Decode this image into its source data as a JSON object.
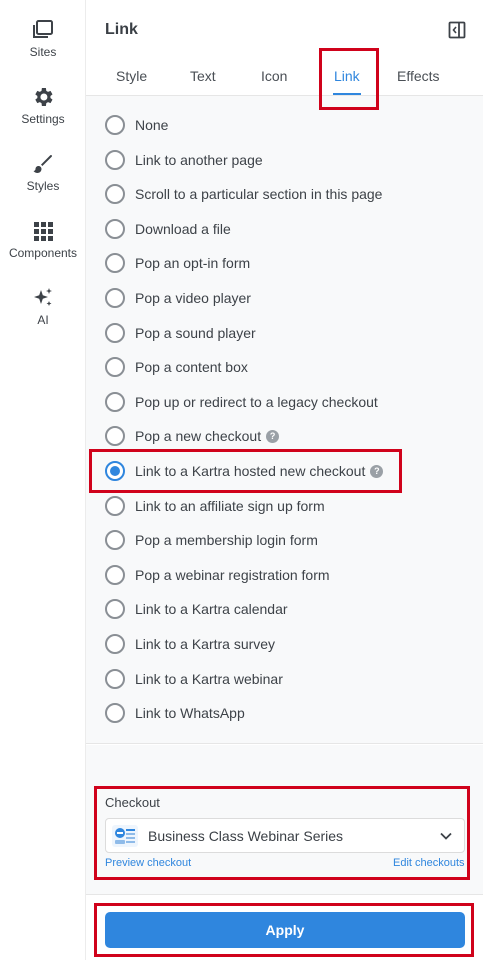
{
  "sidebar": {
    "items": [
      {
        "label": "Sites",
        "icon": "sites-icon"
      },
      {
        "label": "Settings",
        "icon": "gear-icon"
      },
      {
        "label": "Styles",
        "icon": "brush-icon"
      },
      {
        "label": "Components",
        "icon": "grid-icon"
      },
      {
        "label": "AI",
        "icon": "sparkle-icon"
      }
    ]
  },
  "panel": {
    "title": "Link",
    "tabs": [
      {
        "label": "Style"
      },
      {
        "label": "Text"
      },
      {
        "label": "Icon"
      },
      {
        "label": "Link",
        "active": true
      },
      {
        "label": "Effects"
      }
    ]
  },
  "link_options": [
    {
      "label": "None"
    },
    {
      "label": "Link to another page"
    },
    {
      "label": "Scroll to a particular section in this page"
    },
    {
      "label": "Download a file"
    },
    {
      "label": "Pop an opt-in form"
    },
    {
      "label": "Pop a video player"
    },
    {
      "label": "Pop a sound player"
    },
    {
      "label": "Pop a content box"
    },
    {
      "label": "Pop up or redirect to a legacy checkout"
    },
    {
      "label": "Pop a new checkout",
      "help": true
    },
    {
      "label": "Link to a Kartra hosted new checkout",
      "help": true,
      "selected": true
    },
    {
      "label": "Link to an affiliate sign up form"
    },
    {
      "label": "Pop a membership login form"
    },
    {
      "label": "Pop a webinar registration form"
    },
    {
      "label": "Link to a Kartra calendar"
    },
    {
      "label": "Link to a Kartra survey"
    },
    {
      "label": "Link to a Kartra webinar"
    },
    {
      "label": "Link to WhatsApp"
    }
  ],
  "checkout": {
    "label": "Checkout",
    "selected": "Business Class Webinar Series",
    "preview_link": "Preview checkout",
    "edit_link": "Edit checkouts"
  },
  "footer": {
    "apply_label": "Apply"
  },
  "colors": {
    "accent": "#2f86de",
    "highlight": "#d0021b"
  }
}
